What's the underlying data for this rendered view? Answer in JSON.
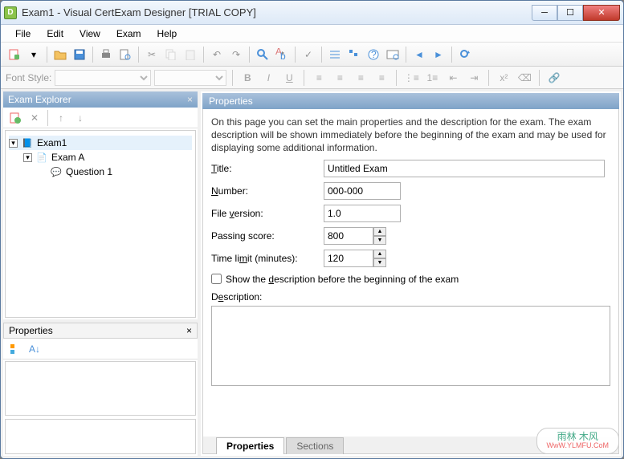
{
  "window": {
    "title": "Exam1 - Visual CertExam Designer [TRIAL COPY]"
  },
  "menu": {
    "file": "File",
    "edit": "Edit",
    "view": "View",
    "exam": "Exam",
    "help": "Help"
  },
  "format": {
    "label": "Font Style:"
  },
  "explorer": {
    "title": "Exam Explorer",
    "root": "Exam1",
    "examA": "Exam A",
    "q1": "Question 1"
  },
  "props_panel": {
    "title": "Properties"
  },
  "right": {
    "title": "Properties",
    "intro": "On this page you can set the main properties and the description for the exam. The exam description will be shown immediately before the beginning of the exam and may be used for displaying some additional information.",
    "title_label": "Title:",
    "title_value": "Untitled Exam",
    "number_label": "Number:",
    "number_value": "000-000",
    "filever_label": "File version:",
    "filever_value": "1.0",
    "passing_label": "Passing score:",
    "passing_value": "800",
    "timelimit_label": "Time limit (minutes):",
    "timelimit_value": "120",
    "showdesc_label": "Show the description before the beginning of the exam",
    "desc_label": "Description:"
  },
  "tabs": {
    "properties": "Properties",
    "sections": "Sections"
  },
  "watermark": {
    "line1": "雨林 木风",
    "line2": "WwW.YLMFU.CoM"
  }
}
